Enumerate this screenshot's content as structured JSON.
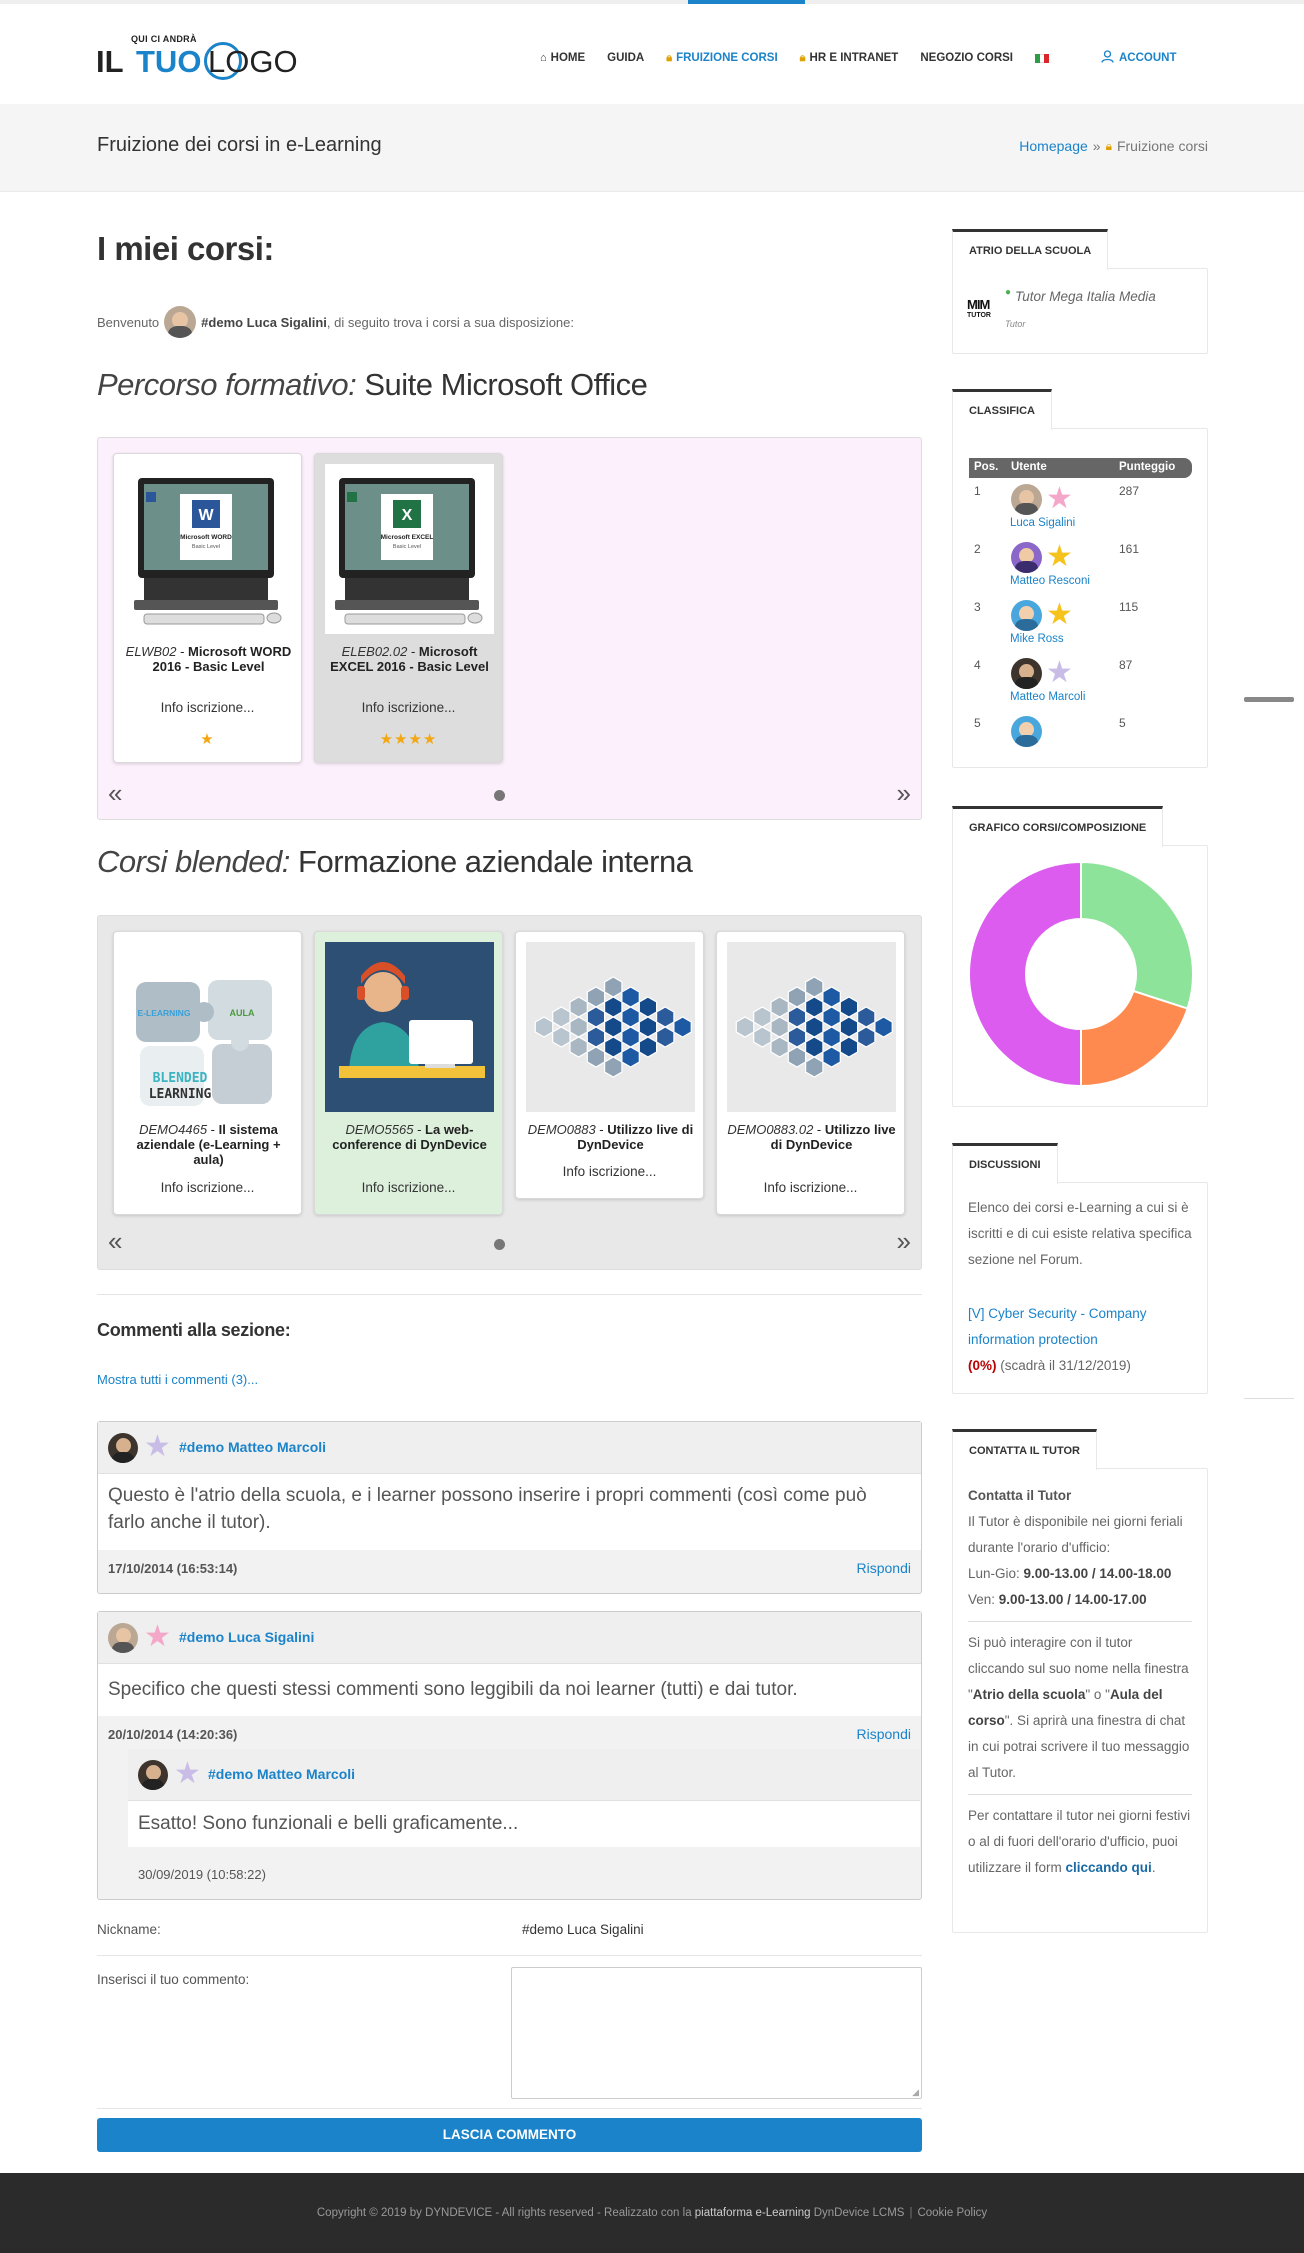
{
  "header": {
    "logo": {
      "pre": "QUI CI ANDRÀ",
      "word1": "IL",
      "word2": "TUO",
      "word3": "LOGO"
    },
    "nav": [
      {
        "label": "HOME",
        "icon": "home-icon"
      },
      {
        "label": "GUIDA"
      },
      {
        "label": "FRUIZIONE CORSI",
        "icon": "lock-icon",
        "active": true
      },
      {
        "label": "HR E INTRANET",
        "icon": "lock-icon"
      },
      {
        "label": "NEGOZIO CORSI"
      }
    ],
    "flag_colors": [
      "#2e9b46",
      "#ffffff",
      "#d8262b"
    ],
    "account_label": "ACCOUNT"
  },
  "titlebar": {
    "title": "Fruizione dei corsi in e-Learning",
    "crumb_home": "Homepage",
    "crumb_sep": "»",
    "crumb_current": "Fruizione corsi"
  },
  "main": {
    "heading": "I miei corsi:",
    "welcome_pre": "Benvenuto",
    "welcome_user": "#demo Luca Sigalini",
    "welcome_post": ", di seguito trova i corsi a sua disposizione:",
    "section1": {
      "em": "Percorso formativo:",
      "rest": " Suite Microsoft Office"
    },
    "section2": {
      "em": "Corsi blended:",
      "rest": " Formazione aziendale interna"
    },
    "courses1": [
      {
        "code": "ELWB02",
        "name": "Microsoft WORD 2016 - Basic Level",
        "info": "Info iscrizione...",
        "stars": "★",
        "screen_title": "Microsoft WORD",
        "screen_sub": "Basic Level",
        "app_letter": "W",
        "app_color": "#2b579a"
      },
      {
        "code": "ELEB02.02",
        "name": "Microsoft EXCEL 2016 - Basic Level",
        "info": "Info iscrizione...",
        "stars": "★★★★",
        "screen_title": "Microsoft EXCEL",
        "screen_sub": "Basic Level",
        "app_letter": "X",
        "app_color": "#217346"
      }
    ],
    "courses2": [
      {
        "code": "DEMO4465",
        "name": "Il sistema aziendale (e-Learning + aula)",
        "info": "Info iscrizione...",
        "puzzle1": "E-LEARNING",
        "puzzle2": "AULA",
        "puzzle3": "BLENDED",
        "puzzle4": "LEARNING"
      },
      {
        "code": "DEMO5565",
        "name": "La web-conference di DynDevice",
        "info": "Info iscrizione..."
      },
      {
        "code": "DEMO0883",
        "name": "Utilizzo live di DynDevice",
        "info": "Info iscrizione..."
      },
      {
        "code": "DEMO0883.02",
        "name": "Utilizzo live di DynDevice",
        "info": "Info iscrizione..."
      }
    ],
    "comments_title": "Commenti alla sezione:",
    "show_all": "Mostra tutti i commenti (3)...",
    "comments": [
      {
        "author": "#demo Matteo Marcoli",
        "text": "Questo è l'atrio della scuola, e i learner possono inserire i propri commenti (così come può farlo anche il tutor).",
        "date": "17/10/2014 (16:53:14)",
        "reply": "Rispondi"
      },
      {
        "author": "#demo Luca Sigalini",
        "text": "Specifico che questi stessi commenti sono leggibili da noi learner (tutti) e dai tutor.",
        "date": "20/10/2014 (14:20:36)",
        "reply": "Rispondi"
      },
      {
        "author": "#demo Matteo Marcoli",
        "text": "Esatto! Sono funzionali e belli graficamente...",
        "date": "30/09/2019 (10:58:22)"
      }
    ],
    "form": {
      "nickname_label": "Nickname:",
      "nickname_value": "#demo Luca Sigalini",
      "comment_label": "Inserisci il tuo commento:",
      "submit": "LASCIA COMMENTO"
    }
  },
  "sidebar": {
    "atrio": {
      "tab": "ATRIO DELLA SCUOLA",
      "logo_top": "MIM",
      "logo_bottom": "TUTOR",
      "tutor_name": "Tutor Mega Italia Media",
      "tutor_role": "Tutor"
    },
    "classifica": {
      "tab": "CLASSIFICA",
      "headers": [
        "Pos.",
        "Utente",
        "Punteggio"
      ],
      "rows": [
        {
          "pos": "1",
          "user": "Luca Sigalini",
          "score": "287",
          "star_color": "#f4a7c8"
        },
        {
          "pos": "2",
          "user": "Matteo Resconi",
          "score": "161",
          "star_color": "#f6c21c"
        },
        {
          "pos": "3",
          "user": "Mike Ross",
          "score": "115",
          "star_color": "#f6c21c"
        },
        {
          "pos": "4",
          "user": "Matteo Marcoli",
          "score": "87",
          "star_color": "#c9bde8"
        },
        {
          "pos": "5",
          "user": "",
          "score": "5"
        }
      ]
    },
    "grafico": {
      "tab": "GRAFICO CORSI/COMPOSIZIONE"
    },
    "discussioni": {
      "tab": "DISCUSSIONI",
      "text": "Elenco dei corsi e-Learning a cui si è iscritti e di cui esiste relativa specifica sezione nel Forum.",
      "link": "[V] Cyber Security - Company information protection",
      "pct": "(0%)",
      "expiry": " (scadrà il 31/12/2019)"
    },
    "tutor": {
      "tab": "CONTATTA IL TUTOR",
      "title": "Contatta il Tutor",
      "p1": "Il Tutor è disponibile nei giorni feriali durante l'orario d'ufficio:",
      "hours1_label": "Lun-Gio:",
      "hours1": "9.00-13.00 / 14.00-18.00",
      "hours2_label": "Ven:",
      "hours2": "9.00-13.00 / 14.00-17.00",
      "p2a": "Si può interagire con il tutor cliccando sul suo nome nella finestra \"",
      "p2b": "Atrio della scuola",
      "p2c": "\" o \"",
      "p2d": "Aula del corso",
      "p2e": "\". Si aprirà una finestra di chat in cui potrai scrivere il tuo messaggio al Tutor.",
      "p3": "Per contattare il tutor nei giorni festivi o al di fuori dell'orario d'ufficio, puoi utilizzare il form ",
      "p3_link": "cliccando qui",
      "p3_end": "."
    }
  },
  "chart_data": {
    "type": "pie",
    "donut": true,
    "slices": [
      {
        "value": 30,
        "color": "#8ee39a"
      },
      {
        "value": 20,
        "color": "#ff8a4f"
      },
      {
        "value": 50,
        "color": "#dc5cf0"
      }
    ]
  },
  "footer": {
    "pre": "Copyright © 2019 by DYNDEVICE - All rights reserved - Realizzato con la ",
    "b1": "piattaforma e-Learning",
    "mid": " DynDevice LCMS",
    "sep": "|",
    "cookie": "Cookie Policy"
  },
  "colors": {
    "accent": "#1a83c9",
    "card_pink_bg": "#fdf0fd",
    "carousel_grey_bg": "#e8e8e8"
  }
}
